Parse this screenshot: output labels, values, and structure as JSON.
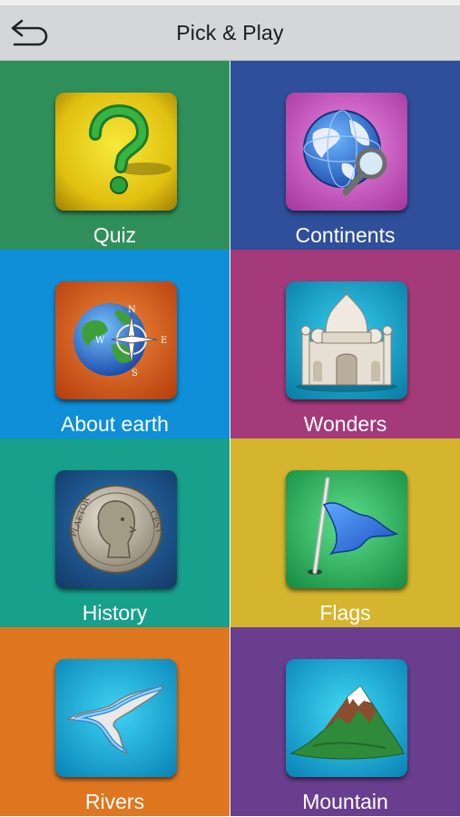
{
  "header": {
    "title": "Pick & Play",
    "back_icon": "back-arrow-icon"
  },
  "tiles": [
    {
      "label": "Quiz",
      "bg": "#2f8f5a",
      "icon": "question-mark-icon"
    },
    {
      "label": "Continents",
      "bg": "#2f4f9b",
      "icon": "globe-magnifier-icon"
    },
    {
      "label": "About earth",
      "bg": "#0e8fd8",
      "icon": "earth-compass-icon"
    },
    {
      "label": "Wonders",
      "bg": "#a43a79",
      "icon": "taj-mahal-icon"
    },
    {
      "label": "History",
      "bg": "#17a08c",
      "icon": "ancient-coin-icon"
    },
    {
      "label": "Flags",
      "bg": "#d4b52d",
      "icon": "flag-icon"
    },
    {
      "label": "Rivers",
      "bg": "#df7620",
      "icon": "river-icon"
    },
    {
      "label": "Mountain",
      "bg": "#6a3e8e",
      "icon": "mountain-icon"
    }
  ]
}
